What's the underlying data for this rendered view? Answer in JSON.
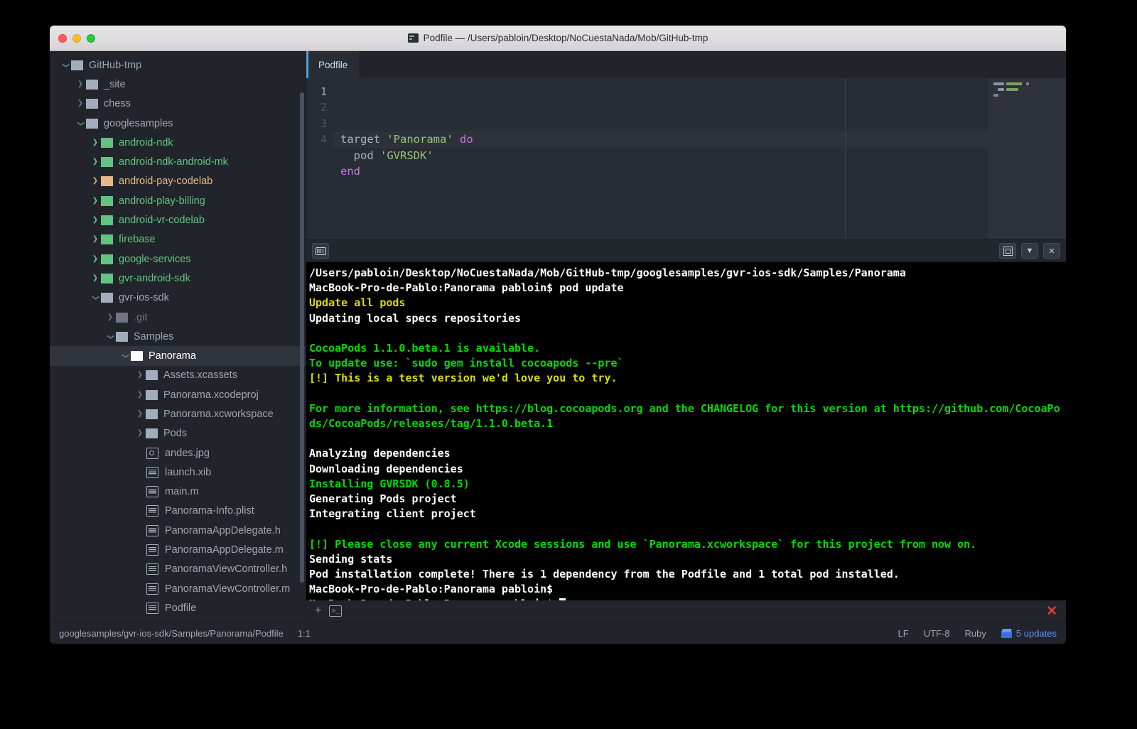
{
  "window": {
    "title": "Podfile — /Users/pabloin/Desktop/NoCuestaNada/Mob/GitHub-tmp",
    "app_icon": "atom-icon",
    "traffic_lights": {
      "close_label": "close",
      "minimize_label": "minimize",
      "maximize_label": "maximize"
    }
  },
  "tree": {
    "scrollbar_present": true,
    "items": [
      {
        "label": "GitHub-tmp",
        "indent": 0,
        "twisty": "down",
        "icon": "folder",
        "color": "gray",
        "twisty_color": "gray"
      },
      {
        "label": "_site",
        "indent": 1,
        "twisty": "right",
        "icon": "folder",
        "color": "gray",
        "twisty_color": "gray"
      },
      {
        "label": "chess",
        "indent": 1,
        "twisty": "right",
        "icon": "folder",
        "color": "gray",
        "twisty_color": "gray"
      },
      {
        "label": "googlesamples",
        "indent": 1,
        "twisty": "down",
        "icon": "folder",
        "color": "gray",
        "twisty_color": "gray"
      },
      {
        "label": "android-ndk",
        "indent": 2,
        "twisty": "right",
        "icon": "folder",
        "color": "green",
        "twisty_color": "green"
      },
      {
        "label": "android-ndk-android-mk",
        "indent": 2,
        "twisty": "right",
        "icon": "folder",
        "color": "green",
        "twisty_color": "green"
      },
      {
        "label": "android-pay-codelab",
        "indent": 2,
        "twisty": "right",
        "icon": "folder",
        "color": "orange",
        "twisty_color": "orange"
      },
      {
        "label": "android-play-billing",
        "indent": 2,
        "twisty": "right",
        "icon": "folder",
        "color": "green",
        "twisty_color": "green"
      },
      {
        "label": "android-vr-codelab",
        "indent": 2,
        "twisty": "right",
        "icon": "folder",
        "color": "green",
        "twisty_color": "green"
      },
      {
        "label": "firebase",
        "indent": 2,
        "twisty": "right",
        "icon": "folder",
        "color": "green",
        "twisty_color": "green"
      },
      {
        "label": "google-services",
        "indent": 2,
        "twisty": "right",
        "icon": "folder",
        "color": "green",
        "twisty_color": "green"
      },
      {
        "label": "gvr-android-sdk",
        "indent": 2,
        "twisty": "right",
        "icon": "folder",
        "color": "green",
        "twisty_color": "green"
      },
      {
        "label": "gvr-ios-sdk",
        "indent": 2,
        "twisty": "down",
        "icon": "folder",
        "color": "gray",
        "twisty_color": "gray"
      },
      {
        "label": ".git",
        "indent": 3,
        "twisty": "right",
        "icon": "folder",
        "color": "dim",
        "twisty_color": "dim"
      },
      {
        "label": "Samples",
        "indent": 3,
        "twisty": "down",
        "icon": "folder",
        "color": "gray",
        "twisty_color": "gray"
      },
      {
        "label": "Panorama",
        "indent": 4,
        "twisty": "down",
        "icon": "folder",
        "color": "white",
        "twisty_color": "white",
        "selected": true
      },
      {
        "label": "Assets.xcassets",
        "indent": 5,
        "twisty": "right",
        "icon": "folder",
        "color": "gray",
        "twisty_color": "gray"
      },
      {
        "label": "Panorama.xcodeproj",
        "indent": 5,
        "twisty": "right",
        "icon": "folder",
        "color": "gray",
        "twisty_color": "gray"
      },
      {
        "label": "Panorama.xcworkspace",
        "indent": 5,
        "twisty": "right",
        "icon": "folder",
        "color": "gray",
        "twisty_color": "gray"
      },
      {
        "label": "Pods",
        "indent": 5,
        "twisty": "right",
        "icon": "folder",
        "color": "gray",
        "twisty_color": "gray"
      },
      {
        "label": "andes.jpg",
        "indent": 5,
        "twisty": "none",
        "icon": "image-file",
        "color": "gray"
      },
      {
        "label": "launch.xib",
        "indent": 5,
        "twisty": "none",
        "icon": "file",
        "color": "gray"
      },
      {
        "label": "main.m",
        "indent": 5,
        "twisty": "none",
        "icon": "file",
        "color": "gray"
      },
      {
        "label": "Panorama-Info.plist",
        "indent": 5,
        "twisty": "none",
        "icon": "file",
        "color": "gray"
      },
      {
        "label": "PanoramaAppDelegate.h",
        "indent": 5,
        "twisty": "none",
        "icon": "file",
        "color": "gray"
      },
      {
        "label": "PanoramaAppDelegate.m",
        "indent": 5,
        "twisty": "none",
        "icon": "file",
        "color": "gray"
      },
      {
        "label": "PanoramaViewController.h",
        "indent": 5,
        "twisty": "none",
        "icon": "file",
        "color": "gray"
      },
      {
        "label": "PanoramaViewController.m",
        "indent": 5,
        "twisty": "none",
        "icon": "file",
        "color": "gray"
      },
      {
        "label": "Podfile",
        "indent": 5,
        "twisty": "none",
        "icon": "file",
        "color": "gray"
      }
    ]
  },
  "tabs": [
    {
      "label": "Podfile",
      "active": true
    }
  ],
  "editor": {
    "line_numbers": [
      "1",
      "2",
      "3",
      "4"
    ],
    "active_line": 1,
    "lines": [
      [
        {
          "t": "target ",
          "c": "plain"
        },
        {
          "t": "'Panorama'",
          "c": "string"
        },
        {
          "t": " ",
          "c": "plain"
        },
        {
          "t": "do",
          "c": "kw"
        }
      ],
      [
        {
          "t": "  pod ",
          "c": "plain"
        },
        {
          "t": "'GVRSDK'",
          "c": "string"
        }
      ],
      [
        {
          "t": "end",
          "c": "kw"
        }
      ],
      []
    ]
  },
  "terminal_toolbar": {
    "keyboard_icon": "keyboard-icon",
    "maximize_icon": "maximize-icon",
    "hide_icon": "chevron-down-icon",
    "close_icon": "close-icon"
  },
  "terminal": {
    "lines": [
      {
        "text": "/Users/pabloin/Desktop/NoCuestaNada/Mob/GitHub-tmp/googlesamples/gvr-ios-sdk/Samples/Panorama",
        "color": "white"
      },
      {
        "text": "MacBook-Pro-de-Pablo:Panorama pabloin$ pod update",
        "color": "white"
      },
      {
        "text": "Update all pods",
        "color": "yellow"
      },
      {
        "text": "Updating local specs repositories",
        "color": "white"
      },
      {
        "text": "",
        "color": "white"
      },
      {
        "text": "CocoaPods 1.1.0.beta.1 is available.",
        "color": "green"
      },
      {
        "text": "To update use: `sudo gem install cocoapods --pre`",
        "color": "green"
      },
      {
        "text": "[!] This is a test version we'd love you to try.",
        "color": "yellow"
      },
      {
        "text": "",
        "color": "white"
      },
      {
        "text": "For more information, see https://blog.cocoapods.org and the CHANGELOG for this version at https://github.com/CocoaPods/CocoaPods/releases/tag/1.1.0.beta.1",
        "color": "green"
      },
      {
        "text": "",
        "color": "white"
      },
      {
        "text": "Analyzing dependencies",
        "color": "white"
      },
      {
        "text": "Downloading dependencies",
        "color": "white"
      },
      {
        "text": "Installing GVRSDK (0.8.5)",
        "color": "green"
      },
      {
        "text": "Generating Pods project",
        "color": "white"
      },
      {
        "text": "Integrating client project",
        "color": "white"
      },
      {
        "text": "",
        "color": "white"
      },
      {
        "text": "[!] Please close any current Xcode sessions and use `Panorama.xcworkspace` for this project from now on.",
        "color": "green"
      },
      {
        "text": "Sending stats",
        "color": "white"
      },
      {
        "text": "Pod installation complete! There is 1 dependency from the Podfile and 1 total pod installed.",
        "color": "white"
      },
      {
        "text": "MacBook-Pro-de-Pablo:Panorama pabloin$",
        "color": "white"
      },
      {
        "text": "MacBook-Pro-de-Pablo:Panorama pabloin$ ",
        "color": "white",
        "cursor": true
      }
    ]
  },
  "terminal_tabbar": {
    "add_label": "+",
    "terminal_tab_label": ">_",
    "close_label": "✕"
  },
  "status_bar": {
    "path": "googlesamples/gvr-ios-sdk/Samples/Panorama/Podfile",
    "cursor_position": "1:1",
    "line_ending": "LF",
    "encoding": "UTF-8",
    "grammar": "Ruby",
    "updates": "5 updates",
    "updates_color": "#6494ed"
  }
}
